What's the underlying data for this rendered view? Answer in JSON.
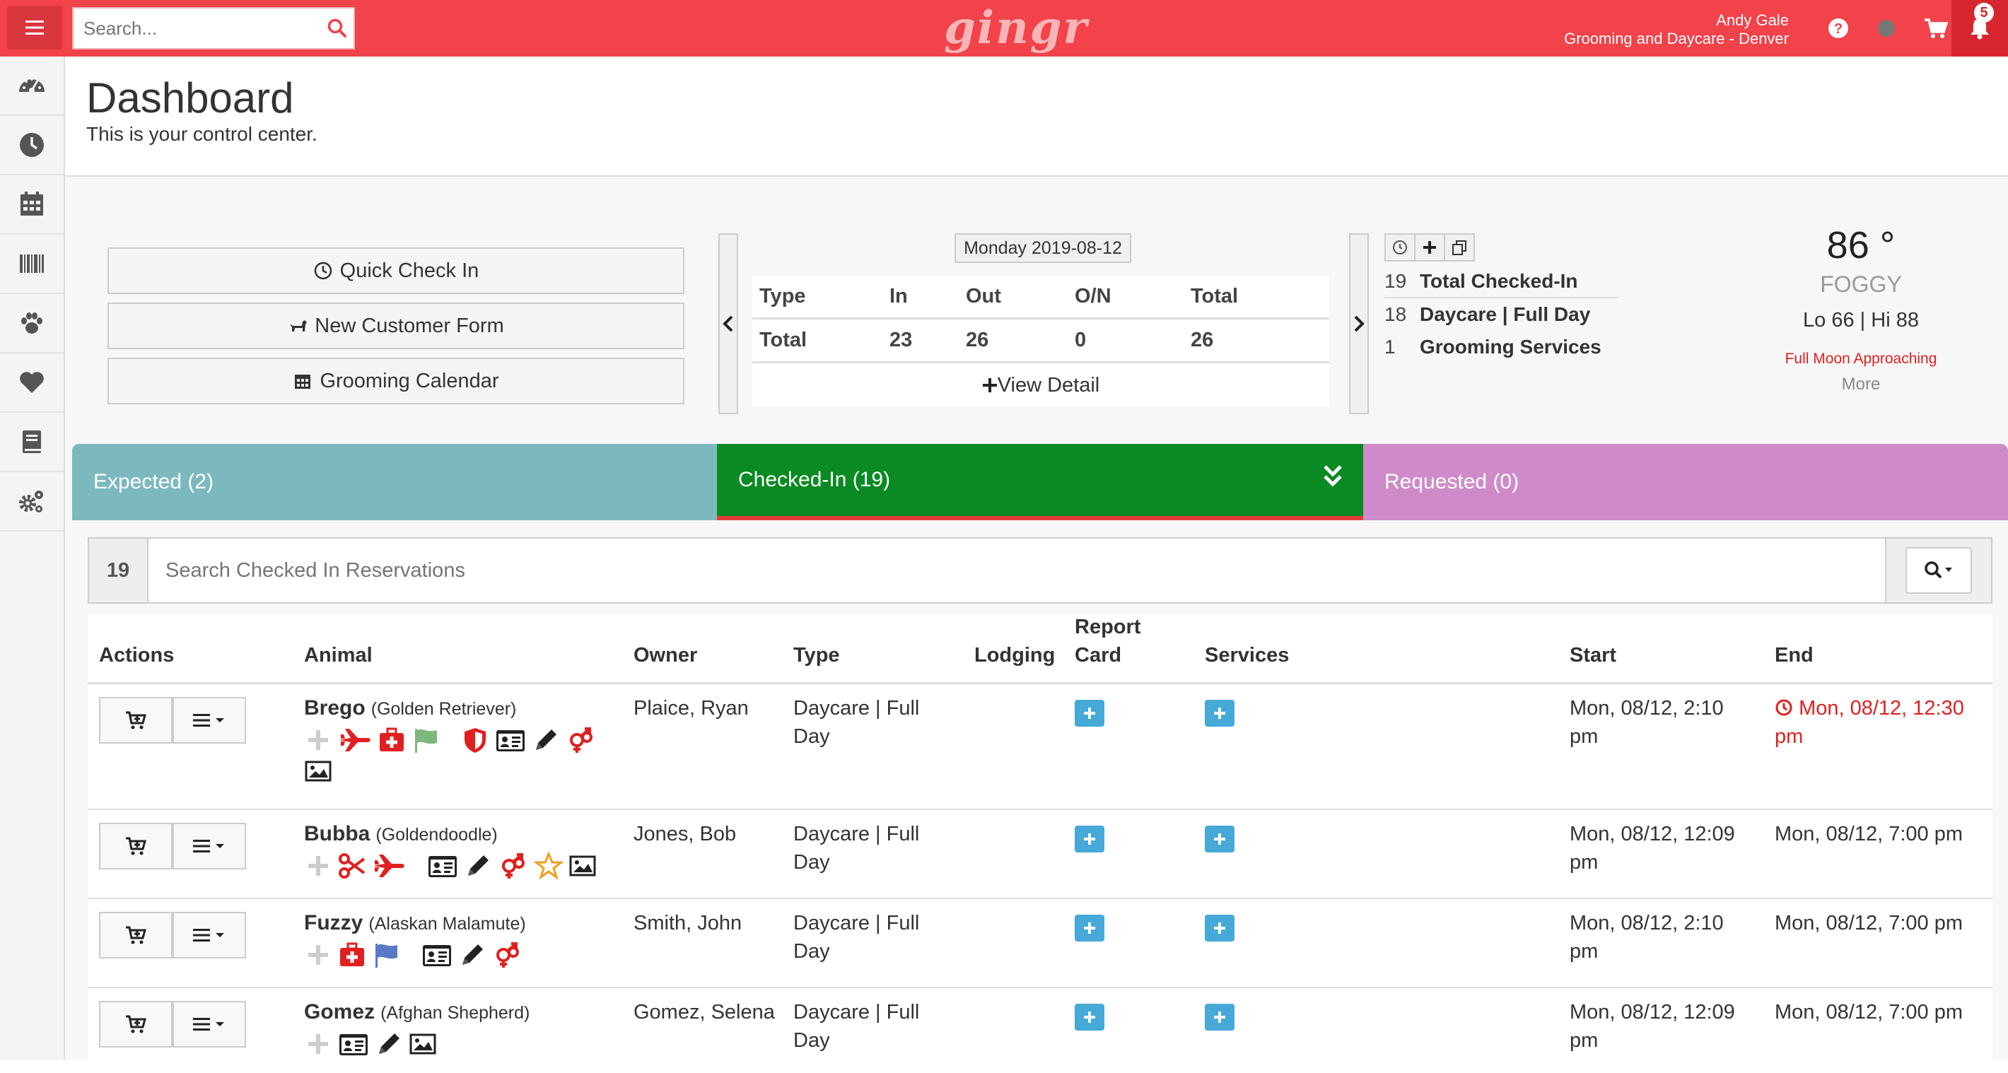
{
  "topbar": {
    "search_placeholder": "Search...",
    "logo": "gingr",
    "user_name": "Andy Gale",
    "location": "Grooming and Daycare - Denver",
    "notifications": "5"
  },
  "header": {
    "title": "Dashboard",
    "subtitle": "This is your control center."
  },
  "quick_actions": [
    {
      "label": "Quick Check In",
      "icon": "clock-icon"
    },
    {
      "label": "New Customer Form",
      "icon": "dog-icon"
    },
    {
      "label": "Grooming Calendar",
      "icon": "calendar-icon"
    }
  ],
  "stats": {
    "date": "Monday 2019-08-12",
    "headers": [
      "Type",
      "In",
      "Out",
      "O/N",
      "Total"
    ],
    "row": [
      "Total",
      "23",
      "26",
      "0",
      "26"
    ],
    "view_detail": "View Detail"
  },
  "summary": [
    {
      "n": "19",
      "label": "Total Checked-In"
    },
    {
      "n": "18",
      "label": "Daycare | Full Day"
    },
    {
      "n": "1",
      "label": "Grooming Services"
    }
  ],
  "weather": {
    "temp": "86 °",
    "condition": "FOGGY",
    "lohi": "Lo 66 | Hi 88",
    "alert": "Full Moon Approaching",
    "more": "More"
  },
  "tabs": {
    "expected": "Expected (2)",
    "checked_in": "Checked-In (19)",
    "requested": "Requested (0)"
  },
  "reservation_search": {
    "count": "19",
    "placeholder": "Search Checked In Reservations"
  },
  "table": {
    "headers": {
      "actions": "Actions",
      "animal": "Animal",
      "owner": "Owner",
      "type": "Type",
      "lodging": "Lodging",
      "report_card_1": "Report",
      "report_card_2": "Card",
      "services": "Services",
      "start": "Start",
      "end": "End"
    },
    "rows": [
      {
        "name": "Brego",
        "breed": "(Golden Retriever)",
        "owner": "Plaice, Ryan",
        "type1": "Daycare | Full",
        "type2": "Day",
        "start1": "Mon, 08/12, 2:10",
        "start2": "pm",
        "end1": "Mon, 08/12, 12:30",
        "end2": "pm"
      },
      {
        "name": "Bubba",
        "breed": "(Goldendoodle)",
        "owner": "Jones, Bob",
        "type1": "Daycare | Full",
        "type2": "Day",
        "start1": "Mon, 08/12, 12:09",
        "start2": "pm",
        "end1": "Mon, 08/12, 7:00 pm",
        "end2": ""
      },
      {
        "name": "Fuzzy",
        "breed": "(Alaskan Malamute)",
        "owner": "Smith, John",
        "type1": "Daycare | Full",
        "type2": "Day",
        "start1": "Mon, 08/12, 2:10",
        "start2": "pm",
        "end1": "Mon, 08/12, 7:00 pm",
        "end2": ""
      },
      {
        "name": "Gomez",
        "breed": "(Afghan Shepherd)",
        "owner": "Gomez, Selena",
        "type1": "Daycare | Full",
        "type2": "Day",
        "start1": "Mon, 08/12, 12:09",
        "start2": "pm",
        "end1": "Mon, 08/12, 7:00 pm",
        "end2": ""
      }
    ]
  },
  "colors": {
    "brand_red": "#f2424a",
    "expected_tab": "#7cb9bf",
    "checked_in_tab": "#098a23",
    "requested_tab": "#cf8bc9",
    "plus_blue": "#46a9d8"
  }
}
